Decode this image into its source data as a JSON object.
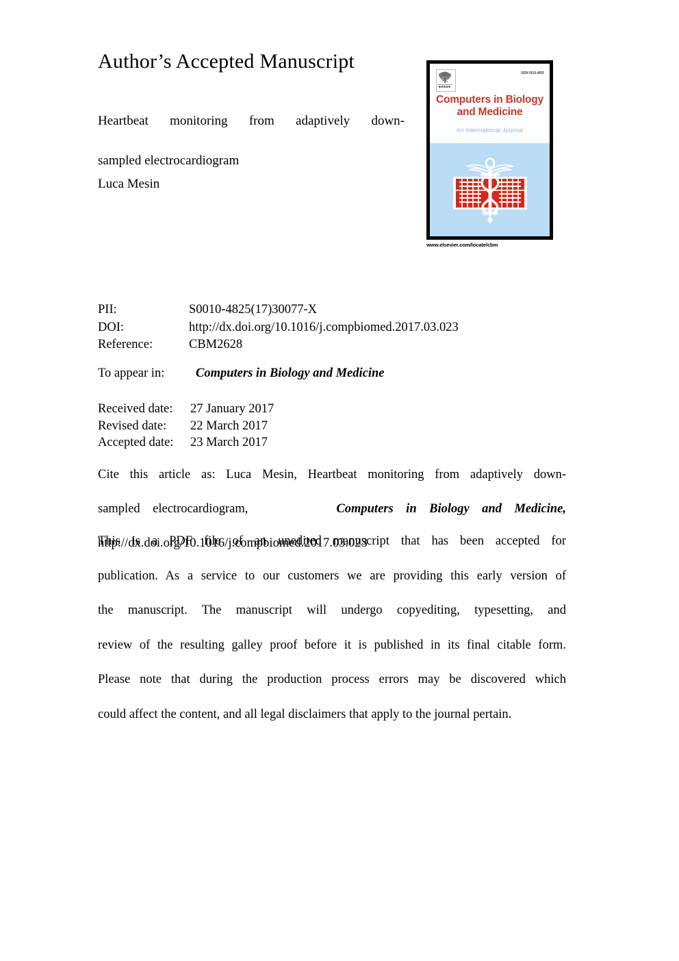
{
  "document": {
    "header": "Author’s Accepted Manuscript",
    "paper_title_line1": "Heartbeat monitoring from adaptively down-",
    "paper_title_line2": "sampled electrocardiogram",
    "author": "Luca Mesin"
  },
  "cover": {
    "issn": "ISSN 0010-4825",
    "title_line1": "Computers in Biology",
    "title_line2": "and Medicine",
    "subtitle": "An International Journal",
    "url": "www.elsevier.com/locate/cbm",
    "logo_name": "elsevier-tree-logo",
    "emblem_name": "caduceus-abacus-emblem",
    "colors": {
      "title_red": "#c0392b",
      "subtitle_blue": "#8fb8d8",
      "panel_blue": "#bbdcf5",
      "abacus_red": "#d42a1e",
      "border": "#000000"
    }
  },
  "metadata": {
    "rows": [
      {
        "label": "PII:",
        "value": "S0010-4825(17)30077-X"
      },
      {
        "label": "DOI:",
        "value": "http://dx.doi.org/10.1016/j.compbiomed.2017.03.023"
      },
      {
        "label": "Reference:",
        "value": "CBM2628"
      }
    ],
    "appear_label": "To appear in:",
    "appear_value": "Computers in Biology and Medicine",
    "dates": [
      {
        "label": "Received date:",
        "value": "27 January 2017"
      },
      {
        "label": "Revised date:",
        "value": "22 March 2017"
      },
      {
        "label": "Accepted date:",
        "value": "23 March 2017"
      }
    ]
  },
  "citation": {
    "line1": "Cite this article as: Luca Mesin, Heartbeat monitoring from adaptively down-",
    "line2_pre": "sampled electrocardiogram,",
    "line2_journal": "Computers in Biology and Medicine,",
    "line3_doi": "http://dx.doi.org/10.1016/j.compbiomed.2017.03.023"
  },
  "disclaimer": {
    "line1": "This is a PDF file of an unedited manuscript that has been accepted for",
    "line2": "publication. As a service to our customers we are providing this early version of",
    "line3": "the manuscript. The manuscript will undergo copyediting, typesetting, and",
    "line4": "review of the resulting galley proof before it is published in its final citable form.",
    "line5": "Please note that during the production process errors may be discovered which",
    "line6": "could affect the content, and all legal disclaimers that apply to the journal pertain."
  }
}
